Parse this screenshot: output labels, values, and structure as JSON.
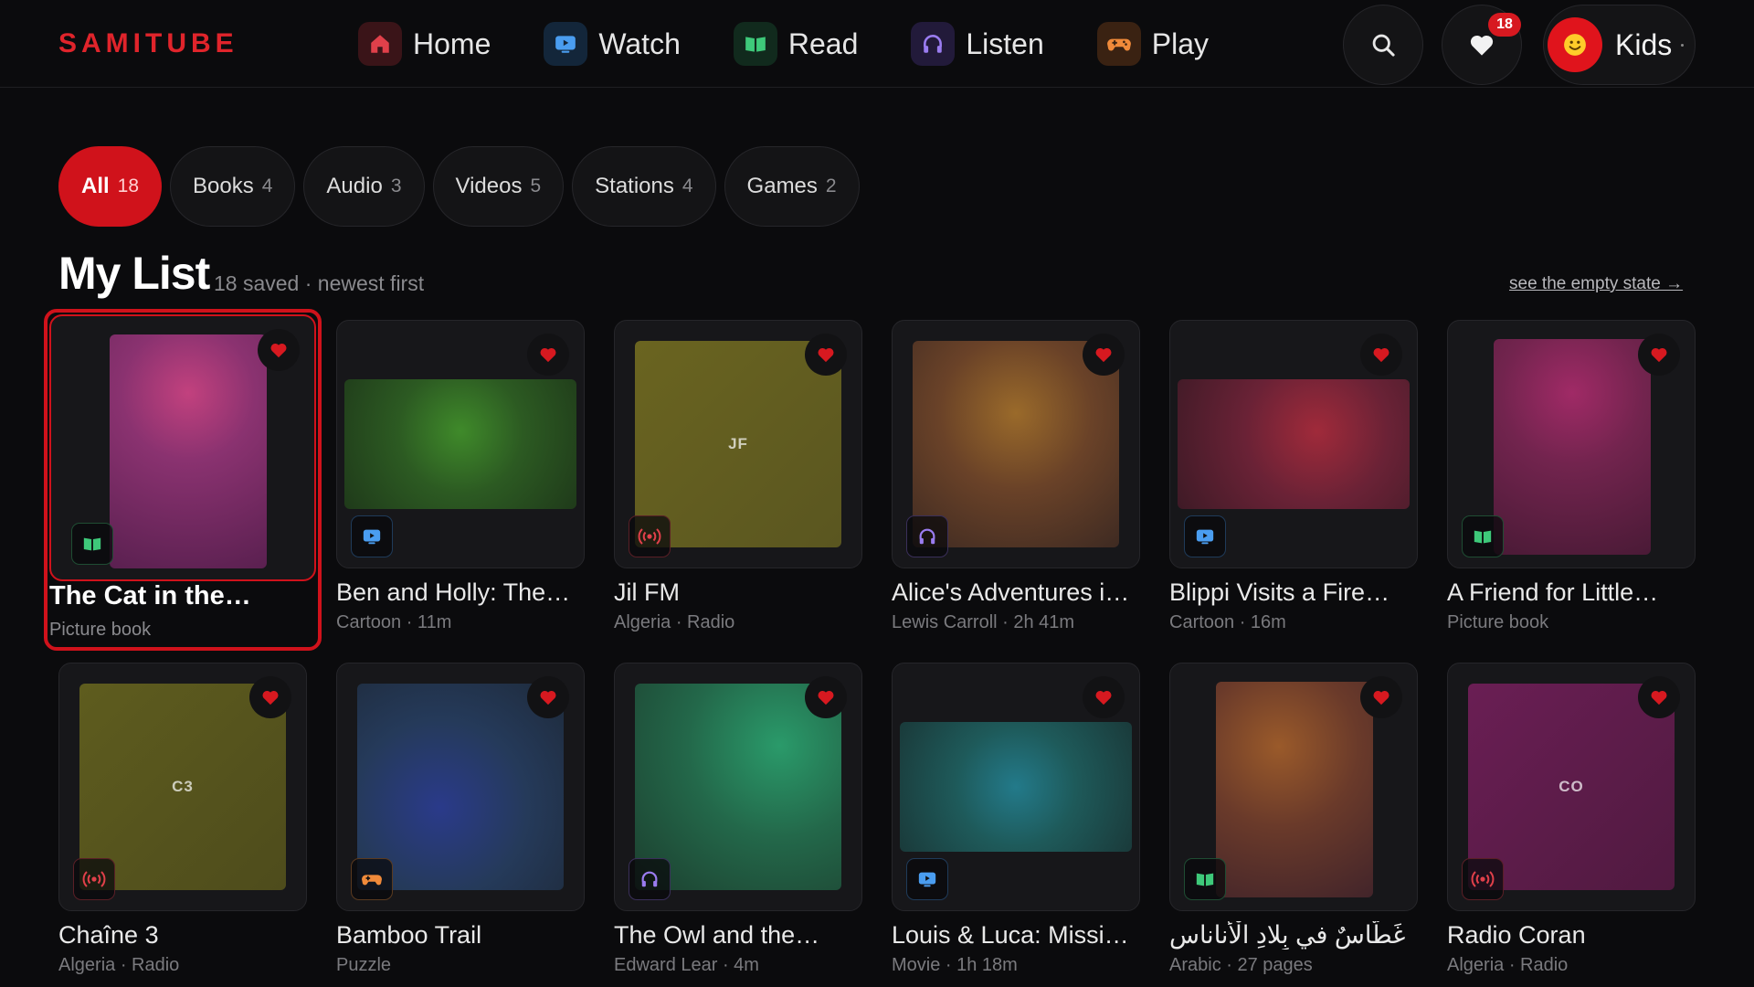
{
  "brand": "SAMITUBE",
  "nav": [
    {
      "label": "Home",
      "icon": "home-icon",
      "color": "#e0404a",
      "bg": "#3a1418"
    },
    {
      "label": "Watch",
      "icon": "tv-icon",
      "color": "#4a9df0",
      "bg": "#13263a"
    },
    {
      "label": "Read",
      "icon": "book-icon",
      "color": "#3ec97a",
      "bg": "#112a1d"
    },
    {
      "label": "Listen",
      "icon": "headphones-icon",
      "color": "#9a7cf0",
      "bg": "#221a3a"
    },
    {
      "label": "Play",
      "icon": "gamepad-icon",
      "color": "#f08a3a",
      "bg": "#3a2212"
    }
  ],
  "header": {
    "favorites_count": "18",
    "profile_name": "Kids"
  },
  "filters": [
    {
      "label": "All",
      "count": "18",
      "active": true
    },
    {
      "label": "Books",
      "count": "4"
    },
    {
      "label": "Audio",
      "count": "3"
    },
    {
      "label": "Videos",
      "count": "5"
    },
    {
      "label": "Stations",
      "count": "4"
    },
    {
      "label": "Games",
      "count": "2"
    }
  ],
  "list": {
    "title": "My List",
    "subtitle": "18 saved · newest first",
    "empty_link": "see the empty state →"
  },
  "items": [
    {
      "title": "The Cat in the…",
      "meta": "Picture book",
      "type": "book",
      "shape": "portrait",
      "art": "radial-gradient(circle at 50% 25%, #c2417e 0%, #8a3270 35%, #5a2050 100%)",
      "initials": ""
    },
    {
      "title": "Ben and Holly: The…",
      "meta": "Cartoon · 11m",
      "type": "video",
      "shape": "wide",
      "art": "radial-gradient(circle at 50% 40%, #3f8a2a 0%, #2c5a22 45%, #1f3a1a 100%)",
      "initials": ""
    },
    {
      "title": "Jil FM",
      "meta": "Algeria · Radio",
      "type": "radio",
      "shape": "square",
      "art": "linear-gradient(135deg, #6a6420 0%, #5a5620 100%)",
      "initials": "JF"
    },
    {
      "title": "Alice's Adventures i…",
      "meta": "Lewis Carroll · 2h 41m",
      "type": "audio",
      "shape": "portrait-wide",
      "art": "radial-gradient(circle at 50% 35%, #9a6a2a 0%, #6a4228 45%, #3e2a22 100%)",
      "initials": ""
    },
    {
      "title": "Blippi Visits a Fire…",
      "meta": "Cartoon · 16m",
      "type": "video",
      "shape": "wide",
      "art": "radial-gradient(circle at 60% 40%, #a02a3a 0%, #6a2236 45%, #3e1a26 100%)",
      "initials": ""
    },
    {
      "title": "A Friend for Little…",
      "meta": "Picture book",
      "type": "book",
      "shape": "portrait",
      "art": "radial-gradient(circle at 50% 25%, #a02a66 0%, #72244e 40%, #4a1a36 100%)",
      "initials": ""
    },
    {
      "title": "Chaîne 3",
      "meta": "Algeria · Radio",
      "type": "radio",
      "shape": "square",
      "art": "linear-gradient(135deg, #5e5c1e 0%, #4e4c1c 100%)",
      "initials": "C3"
    },
    {
      "title": "Bamboo Trail",
      "meta": "Puzzle",
      "type": "game",
      "shape": "square",
      "art": "radial-gradient(circle at 40% 60%, #2a3a8a 0%, #253a5a 50%, #1e2a3a 100%)",
      "initials": ""
    },
    {
      "title": "The Owl and the…",
      "meta": "Edward Lear · 4m",
      "type": "audio",
      "shape": "square",
      "art": "radial-gradient(circle at 70% 30%, #2a9a6a 0%, #23684a 45%, #1c3e2e 100%)",
      "initials": ""
    },
    {
      "title": "Louis & Luca: Missio…",
      "meta": "Movie · 1h 18m",
      "type": "video",
      "shape": "wide",
      "art": "radial-gradient(circle at 50% 50%, #237a8a 0%, #1e5a5a 45%, #1a3a3a 100%)",
      "initials": ""
    },
    {
      "title": "غَطّاسٌ في بِلادِ الْأَناناس",
      "meta": "Arabic · 27 pages",
      "type": "book",
      "shape": "portrait",
      "art": "radial-gradient(circle at 40% 30%, #9a5a2a 0%, #6a3a2a 45%, #42242a 100%)",
      "initials": ""
    },
    {
      "title": "Radio Coran",
      "meta": "Algeria · Radio",
      "type": "radio",
      "shape": "square",
      "art": "linear-gradient(135deg, #6a1e54 0%, #501a40 100%)",
      "initials": "CO"
    }
  ],
  "type_colors": {
    "book": "#3ec97a",
    "video": "#4a9df0",
    "radio": "#e0404a",
    "audio": "#9a7cf0",
    "game": "#f08a3a"
  },
  "accent": "#d0121b"
}
